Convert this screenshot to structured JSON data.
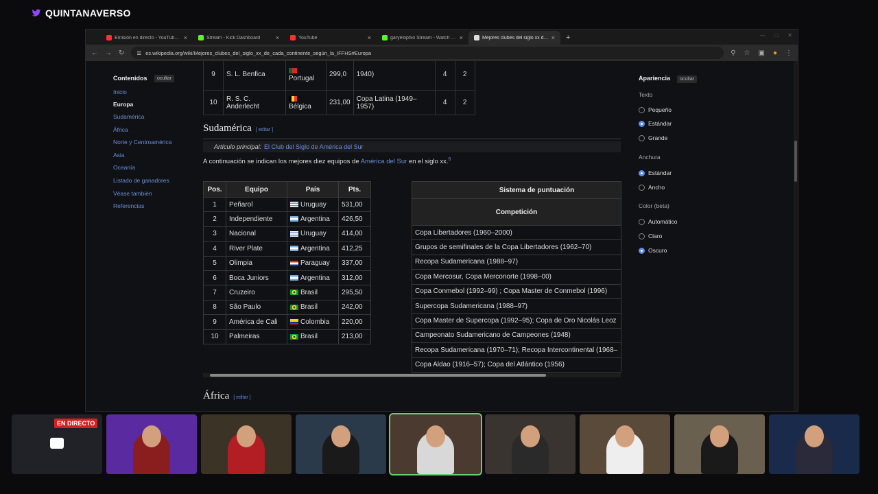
{
  "brand": {
    "name": "QUINTANAVERSO"
  },
  "browser": {
    "tabs": [
      {
        "title": "Emisión en directo - YouTube Studio",
        "color": "#ff3030"
      },
      {
        "title": "Stream - Kick Dashboard",
        "color": "#53fc18"
      },
      {
        "title": "YouTube",
        "color": "#ff3030"
      },
      {
        "title": "garyelophio Stream - Watch Live on Kick",
        "color": "#53fc18"
      },
      {
        "title": "Mejores clubes del siglo xx de cada continente",
        "color": "#dddddd"
      }
    ],
    "url": "es.wikipedia.org/wiki/Mejores_clubes_del_siglo_xx_de_cada_continente_según_la_IFFHS#Europa"
  },
  "toc": {
    "title": "Contenidos",
    "hide": "ocultar",
    "items": [
      "Inicio",
      "Europa",
      "Sudamérica",
      "África",
      "Norte y Centroamérica",
      "Asia",
      "Oceanía",
      "Listado de ganadores",
      "Véase también",
      "Referencias"
    ]
  },
  "europe_rows": [
    {
      "pos": "9",
      "team": "S. L. Benfica",
      "country": "Portugal",
      "pts": "299,0",
      "comp": "1940)",
      "a": "4",
      "b": "2"
    },
    {
      "pos": "10",
      "team": "R. S. C. Anderlecht",
      "country": "Bélgica",
      "pts": "231,00",
      "comp": "Copa Latina (1949–1957)",
      "a": "4",
      "b": "2"
    }
  ],
  "south": {
    "heading": "Sudamérica",
    "edit": "editar",
    "hat_label": "Artículo principal:",
    "hat_link": "El Club del Siglo de América del Sur",
    "intro_before": "A continuación se indican los mejores diez equipos de ",
    "intro_link": "América del Sur",
    "intro_after": " en el siglo xx.",
    "intro_ref": "6",
    "cols": [
      "Pos.",
      "Equipo",
      "País",
      "Pts."
    ],
    "rows": [
      {
        "pos": "1",
        "team": "Peñarol",
        "country": "Uruguay",
        "flag": "uy",
        "pts": "531,00"
      },
      {
        "pos": "2",
        "team": "Independiente",
        "country": "Argentina",
        "flag": "ar",
        "pts": "426,50"
      },
      {
        "pos": "3",
        "team": "Nacional",
        "country": "Uruguay",
        "flag": "uy",
        "pts": "414,00"
      },
      {
        "pos": "4",
        "team": "River Plate",
        "country": "Argentina",
        "flag": "ar",
        "pts": "412,25"
      },
      {
        "pos": "5",
        "team": "Olimpia",
        "country": "Paraguay",
        "flag": "py",
        "pts": "337,00"
      },
      {
        "pos": "6",
        "team": "Boca Juniors",
        "country": "Argentina",
        "flag": "ar",
        "pts": "312,00"
      },
      {
        "pos": "7",
        "team": "Cruzeiro",
        "country": "Brasil",
        "flag": "br",
        "pts": "295,50"
      },
      {
        "pos": "8",
        "team": "São Paulo",
        "country": "Brasil",
        "flag": "br",
        "pts": "242,00"
      },
      {
        "pos": "9",
        "team": "América de Cali",
        "country": "Colombia",
        "flag": "co",
        "pts": "220,00"
      },
      {
        "pos": "10",
        "team": "Palmeiras",
        "country": "Brasil",
        "flag": "br",
        "pts": "213,00"
      }
    ],
    "sys_title": "Sistema de puntuación",
    "sys_sub": "Competición",
    "sys_rows": [
      "Copa Libertadores (1960–2000)",
      "Grupos de semifinales de la Copa Libertadores (1962–70)",
      "Recopa Sudamericana (1988–97)",
      "Copa Mercosur, Copa Merconorte (1998–00)",
      "Copa Conmebol (1992–99) ; Copa Master de Conmebol (1996)",
      "Supercopa Sudamericana (1988–97)",
      "Copa Master de Supercopa (1992–95); Copa de Oro Nicolás Leoz",
      "Campeonato Sudamericano de Campeones (1948)",
      "Recopa Sudamericana (1970–71); Recopa Intercontinental (1968–",
      "Copa Aldao (1916–57); Copa del Atlántico (1956)"
    ]
  },
  "africa": {
    "heading": "África",
    "edit": "editar"
  },
  "appearance": {
    "title": "Apariencia",
    "hide": "ocultar",
    "text_group": "Texto",
    "text_options": [
      "Pequeño",
      "Estándar",
      "Grande"
    ],
    "width_group": "Anchura",
    "width_options": [
      "Estándar",
      "Ancho"
    ],
    "color_group": "Color (beta)",
    "color_options": [
      "Automático",
      "Claro",
      "Oscuro"
    ]
  },
  "stream": {
    "live_label": "EN DIRECTO"
  },
  "colors": {
    "twitch": "#9146ff",
    "link": "#6b8fd6",
    "radio_on": "#5a8cf0",
    "live": "#d62020"
  }
}
